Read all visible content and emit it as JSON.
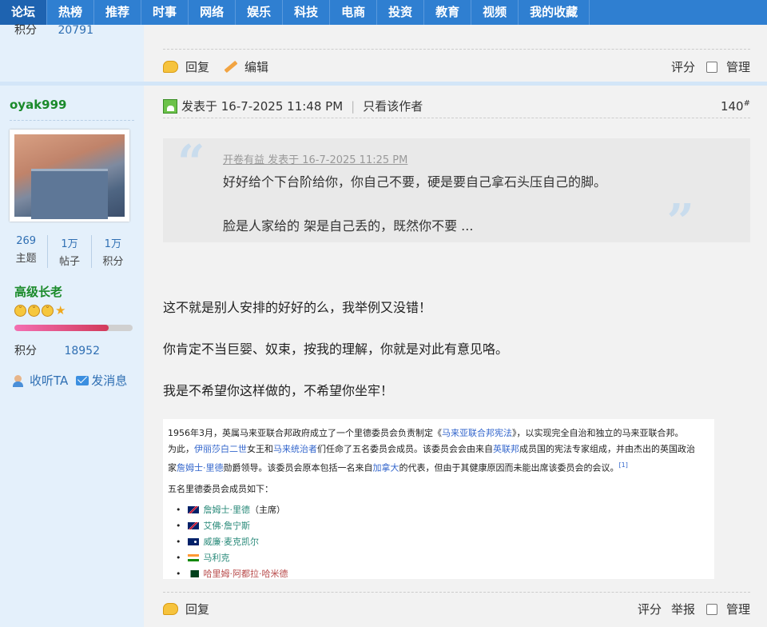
{
  "nav": [
    "论坛",
    "热榜",
    "推荐",
    "时事",
    "网络",
    "娱乐",
    "科技",
    "电商",
    "投资",
    "教育",
    "视频",
    "我的收藏"
  ],
  "prev_post": {
    "score_label": "积分",
    "score_value": "20791",
    "reply": "回复",
    "edit": "编辑",
    "rate": "评分",
    "manage": "管理"
  },
  "user": {
    "name": "oyak999",
    "stats": [
      {
        "num": "269",
        "label": "主题"
      },
      {
        "num": "1万",
        "label": "帖子"
      },
      {
        "num": "1万",
        "label": "积分"
      }
    ],
    "rank": "高级长老",
    "rank_progress": 0.8,
    "score_label": "积分",
    "score_value": "18952",
    "follow": "收听TA",
    "message": "发消息"
  },
  "post": {
    "posted": "发表于 16-7-2025 11:48 PM",
    "only_author": "只看该作者",
    "floor": "140",
    "floor_mark": "#",
    "quote": {
      "meta": "开卷有益 发表于 16-7-2025 11:25 PM",
      "line1": "好好给个下台阶给你，你自己不要，硬是要自己拿石头压自己的脚。",
      "line2": "脸是人家给的 架是自己丢的，既然你不要 ..."
    },
    "lines": [
      "这不就是别人安排的好好的么，我举例又没错！",
      "你肯定不当巨婴、奴束，按我的理解，你就是对此有意见咯。",
      "我是不希望你这样做的，不希望你坐牢！"
    ],
    "embed": {
      "p1_a": "1956年3月，英属马来亚联合邦政府成立了一个里德委员会负责制定《",
      "p1_link": "马来亚联合邦宪法",
      "p1_b": "》，以实现完全自治和独立的马来亚联合邦。",
      "p2_a": "为此，",
      "p2_link1": "伊丽莎白二世",
      "p2_b": "女王和",
      "p2_link2": "马来统治者",
      "p2_c": "们任命了五名委员会成员。该委员会会由来自",
      "p2_link3": "英联邦",
      "p2_d": "成员国的宪法专家组成，并由杰出的英国政治",
      "p3_a": "家",
      "p3_link1": "詹姆士·里德",
      "p3_b": "勋爵领导。该委员会原本包括一名来自",
      "p3_link2": "加拿大",
      "p3_c": "的代表，但由于其健康原因而未能出席该委员会的会议。",
      "p3_sup": "[1]",
      "members_head": "五名里德委员会成员如下：",
      "members": [
        {
          "flag": "uk",
          "name": "詹姆士·里德",
          "note": "（主席）"
        },
        {
          "flag": "uk",
          "name": "艾佛·詹宁斯",
          "note": ""
        },
        {
          "flag": "au",
          "name": "威廉·麦克凯尔",
          "note": ""
        },
        {
          "flag": "in",
          "name": "马利克",
          "note": ""
        },
        {
          "flag": "pk",
          "name": "哈里姆·阿都拉·哈米德",
          "note": ""
        }
      ]
    },
    "reply": "回复",
    "rate": "评分",
    "report": "举报",
    "manage": "管理"
  }
}
